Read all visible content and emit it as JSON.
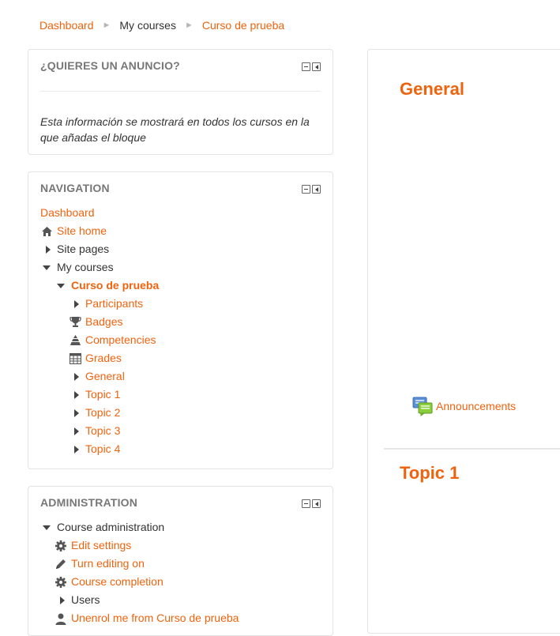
{
  "breadcrumb": {
    "items": [
      "Dashboard",
      "My courses",
      "Curso de prueba"
    ],
    "separator": "►"
  },
  "ad_block": {
    "title": "¿QUIERES UN ANUNCIO?",
    "text": "Esta información se mostrará en todos los cursos en la que añadas el bloque"
  },
  "navigation": {
    "title": "NAVIGATION",
    "items": [
      {
        "label": "Dashboard",
        "icon": "none"
      },
      {
        "label": "Site home",
        "icon": "home-icon"
      },
      {
        "label": "Site pages",
        "icon": "collapsed-arrow-icon"
      },
      {
        "label": "My courses",
        "icon": "expanded-arrow-icon"
      },
      {
        "label": "Curso de prueba",
        "icon": "expanded-arrow-icon"
      },
      {
        "label": "Participants",
        "icon": "collapsed-arrow-icon"
      },
      {
        "label": "Badges",
        "icon": "trophy-icon"
      },
      {
        "label": "Competencies",
        "icon": "competencies-icon"
      },
      {
        "label": "Grades",
        "icon": "table-icon"
      },
      {
        "label": "General",
        "icon": "collapsed-arrow-icon"
      },
      {
        "label": "Topic 1",
        "icon": "collapsed-arrow-icon"
      },
      {
        "label": "Topic 2",
        "icon": "collapsed-arrow-icon"
      },
      {
        "label": "Topic 3",
        "icon": "collapsed-arrow-icon"
      },
      {
        "label": "Topic 4",
        "icon": "collapsed-arrow-icon"
      }
    ]
  },
  "administration": {
    "title": "ADMINISTRATION",
    "items": [
      {
        "label": "Course administration",
        "icon": "expanded-arrow-icon"
      },
      {
        "label": "Edit settings",
        "icon": "gear-icon"
      },
      {
        "label": "Turn editing on",
        "icon": "pencil-icon"
      },
      {
        "label": "Course completion",
        "icon": "gear-icon"
      },
      {
        "label": "Users",
        "icon": "collapsed-arrow-icon"
      },
      {
        "label": "Unenrol me from Curso de prueba",
        "icon": "user-icon"
      }
    ]
  },
  "main": {
    "sections": [
      {
        "title": "General",
        "activities": [
          {
            "label": "Announcements",
            "icon": "forum-icon"
          }
        ]
      },
      {
        "title": "Topic 1"
      }
    ]
  },
  "colors": {
    "accent": "#f0630e",
    "text": "#333333",
    "block_title": "#777777",
    "border": "#e3e3e3"
  }
}
